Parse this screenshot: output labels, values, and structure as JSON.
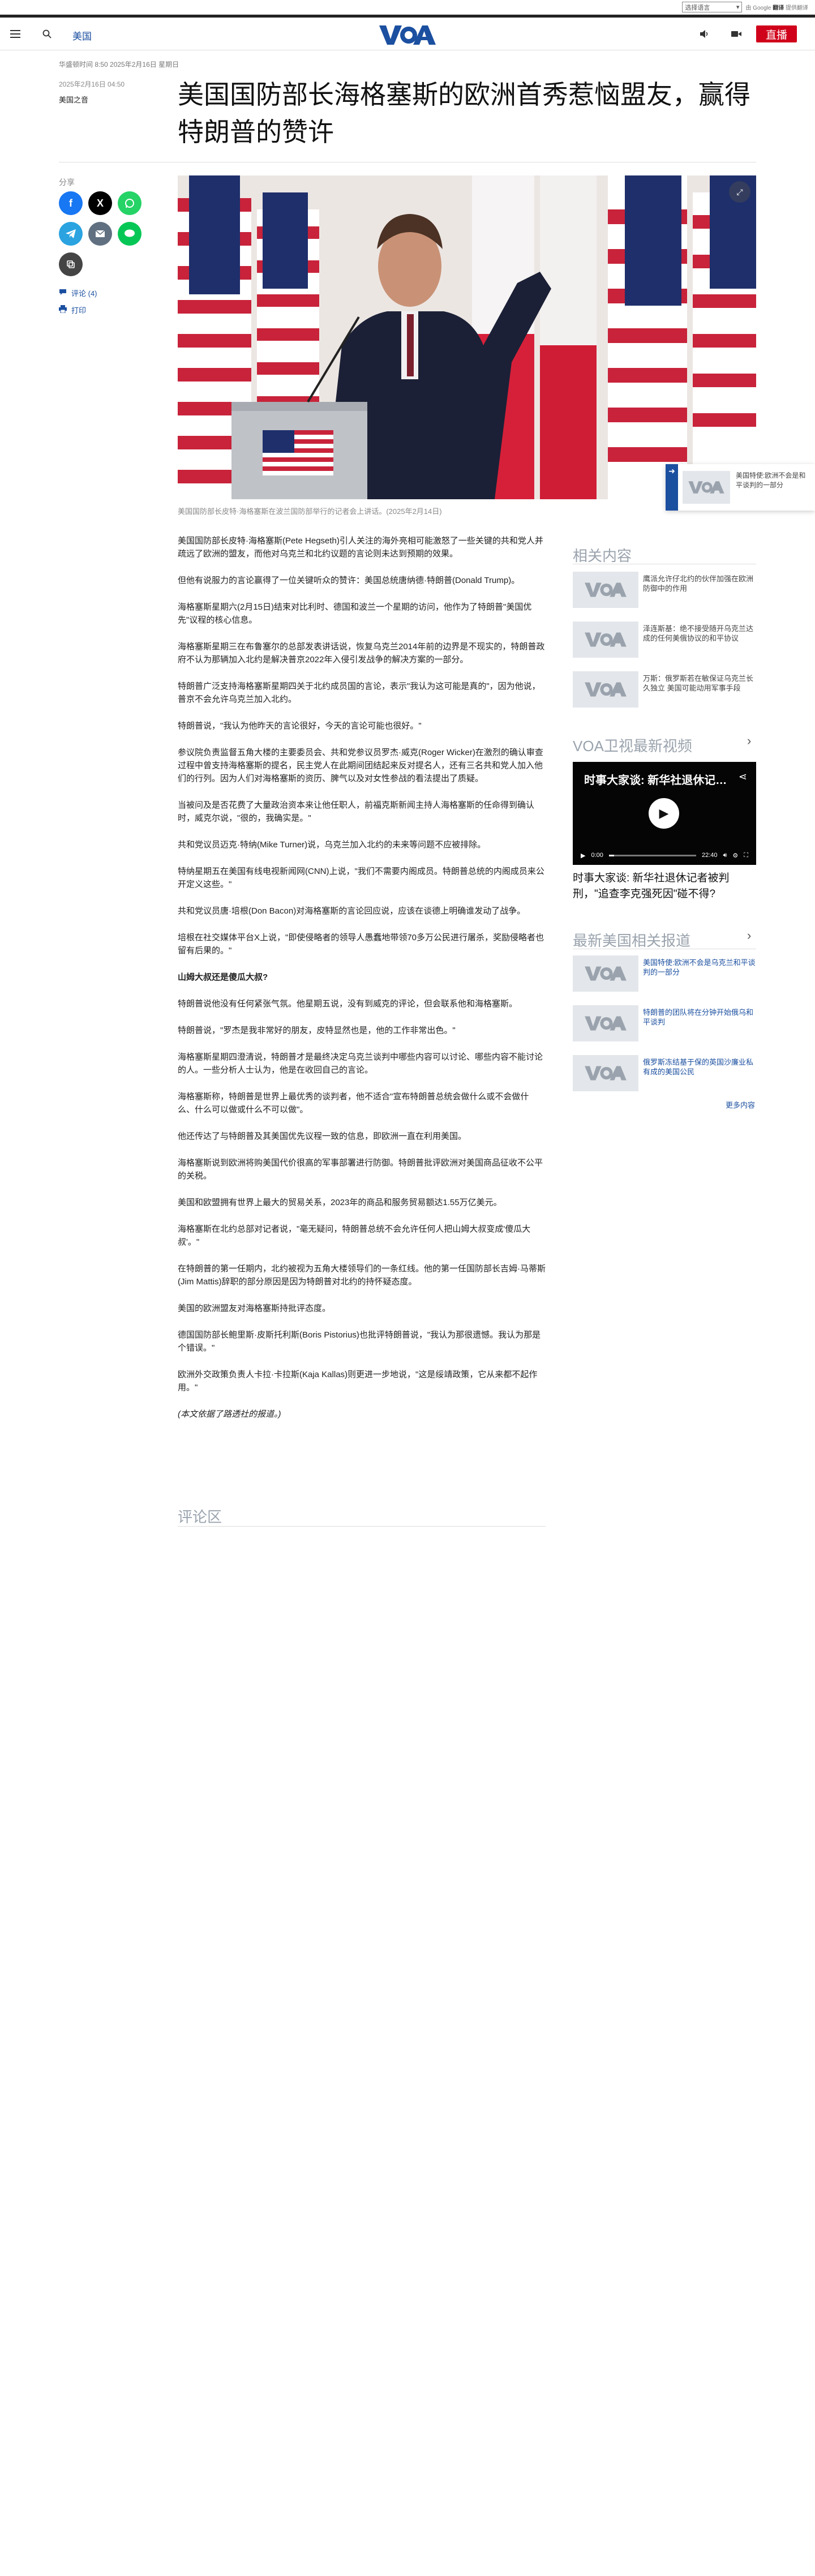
{
  "translate": {
    "select_label": "选择语言",
    "powered": "由 Google",
    "brand": "翻译",
    "suffix": "提供翻译"
  },
  "nav": {
    "section": "美国",
    "live": "直播"
  },
  "article": {
    "dateline": "华盛顿时间 8:50 2025年2月16日 星期日",
    "date": "2025年2月16日 04:50",
    "author": "美国之音",
    "title": "美国国防部长海格塞斯的欧洲首秀惹恼盟友，赢得特朗普的赞许",
    "share_label": "分享",
    "comments_link": "评论 (4)",
    "print_link": "打印",
    "hero_caption": "美国国防部长皮特·海格塞斯在波兰国防部举行的记者会上讲话。(2025年2月14日)",
    "paragraphs": [
      "美国国防部长皮特·海格塞斯(Pete Hegseth)引人关注的海外亮相可能激怒了一些关键的共和党人并疏远了欧洲的盟友，而他对乌克兰和北约议题的言论则未达到预期的效果。",
      "但他有说服力的言论赢得了一位关键听众的赞许：美国总统唐纳德·特朗普(Donald Trump)。",
      "海格塞斯星期六(2月15日)结束对比利时、德国和波兰一个星期的访问，他作为了特朗普\"美国优先\"议程的核心信息。",
      "海格塞斯星期三在布鲁塞尔的总部发表讲话说，恢复乌克兰2014年前的边界是不现实的，特朗普政府不认为那辆加入北约是解决普京2022年入侵引发战争的解决方案的一部分。",
      "特朗普广泛支持海格塞斯星期四关于北约成员国的言论，表示\"我认为这可能是真的\"，因为他说，普京不会允许乌克兰加入北约。",
      "特朗普说，\"我认为他昨天的言论很好，今天的言论可能也很好。\"",
      "参议院负责监督五角大楼的主要委员会、共和党参议员罗杰·威克(Roger Wicker)在激烈的确认审查过程中曾支持海格塞斯的提名，民主党人在此期间团结起来反对提名人，还有三名共和党人加入他们的行列。因为人们对海格塞斯的资历、脾气以及对女性参战的看法提出了质疑。",
      "当被问及是否花费了大量政治资本来让他任职人，前福克斯新闻主持人海格塞斯的任命得到确认时，威克尔说，\"很的，我确实是。\"",
      "共和党议员迈克·特纳(Mike Turner)说，乌克兰加入北约的未来等问题不应被排除。",
      "特纳星期五在美国有线电视新闻网(CNN)上说，\"我们不需要内阁成员。特朗普总统的内阁成员来公开定义这些。\"",
      "共和党议员唐·培根(Don Bacon)对海格塞斯的言论回应说，应该在谈德上明确谁发动了战争。",
      "培根在社交媒体平台X上说，\"即使侵略者的领导人愚蠢地带领70多万公民进行屠杀，奖励侵略者也留有后果的。\"",
      "山姆大叔还是傻瓜大叔?",
      "特朗普说他没有任何紧张气氛。他星期五说，没有到威克的评论，但会联系他和海格塞斯。",
      "特朗普说，\"罗杰是我非常好的朋友，皮特显然也是，他的工作非常出色。\"",
      "海格塞斯星期四澄清说，特朗普才是最终决定乌克兰谈判中哪些内容可以讨论、哪些内容不能讨论的人。一些分析人士认为，他是在收回自己的言论。",
      "海格塞斯称，特朗普是世界上最优秀的谈判者，他不适合\"宣布特朗普总统会做什么或不会做什么、什么可以做或什么不可以做\"。",
      "他还传达了与特朗普及其美国优先议程一致的信息，即欧洲一直在利用美国。",
      "海格塞斯说到欧洲将购美国代价很高的军事部署进行防御。特朗普批评欧洲对美国商品征收不公平的关税。",
      "美国和欧盟拥有世界上最大的贸易关系，2023年的商品和服务贸易额达1.55万亿美元。",
      "海格塞斯在北约总部对记者说，\"毫无疑问，特朗普总统不会允许任何人把山姆大叔变成'傻瓜大叔'。\"",
      "在特朗普的第一任期内，北约被视为五角大楼领导们的一条红线。他的第一任国防部长吉姆·马蒂斯(Jim Mattis)辞职的部分原因是因为特朗普对北约的持怀疑态度。",
      "美国的欧洲盟友对海格塞斯持批评态度。",
      "德国国防部长鲍里斯·皮斯托利斯(Boris Pistorius)也批评特朗普说，\"我认为那很遗憾。我认为那是个错误。\"",
      "欧洲外交政策负责人卡拉·卡拉斯(Kaja Kallas)则更进一步地说，\"这是绥靖政策，它从来都不起作用。\"",
      "(本文依据了路透社的报道。)"
    ],
    "comments_heading": "评论区"
  },
  "floating": {
    "text": "美国特使:欧洲不会是和平谈判的一部分"
  },
  "rail": {
    "related_heading": "相关内容",
    "related": [
      "鹰派允许仔北约的伙伴加强在欧洲防御中的作用",
      "泽连斯基：绝不接受随开乌克兰达成的任何美俄协议的和平协议",
      "万斯：俄罗斯若在敏保证乌克兰长久独立 美国可能动用军事手段"
    ],
    "video_heading": "VOA卫视最新视频",
    "video": {
      "title": "时事大家谈: 新华社退休记…",
      "time_current": "0:00",
      "time_total": "22:40",
      "progress": 0.06
    },
    "video_caption": "时事大家谈: 新华社退休记者被判刑，\"追查李克强死因\"碰不得?",
    "latest_heading": "最新美国相关报道",
    "latest": [
      "美国特使:欧洲不会是乌克兰和平谈判的一部分",
      "特朗普的团队将在分钟开始俄乌和平谈判",
      "俄罗斯冻结基于保的英国沙廉业私有成的美国公民"
    ],
    "more_label": "更多内容"
  }
}
